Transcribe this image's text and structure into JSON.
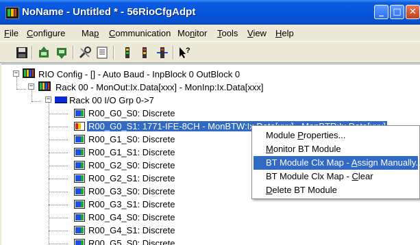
{
  "window": {
    "title": "NoName - Untitled * - 56RioCfgAdpt",
    "min_glyph": "_",
    "max_glyph": "□",
    "close_glyph": "✕"
  },
  "menubar": [
    {
      "key": "file",
      "pre": "",
      "u": "F",
      "post": "ile"
    },
    {
      "key": "configure",
      "pre": "",
      "u": "C",
      "post": "onfigure"
    },
    {
      "key": "map",
      "pre": "Ma",
      "u": "p",
      "post": ""
    },
    {
      "key": "communication",
      "pre": "",
      "u": "C",
      "post": "ommunication"
    },
    {
      "key": "monitor",
      "pre": "Mo",
      "u": "n",
      "post": "itor"
    },
    {
      "key": "tools",
      "pre": "",
      "u": "T",
      "post": "ools"
    },
    {
      "key": "view",
      "pre": "",
      "u": "V",
      "post": "iew"
    },
    {
      "key": "help",
      "pre": "",
      "u": "H",
      "post": "elp"
    }
  ],
  "toolbar": {
    "icons": [
      "save-icon",
      "upload-icon",
      "download-icon",
      "tools-icon",
      "properties-icon",
      "module-icon",
      "module-alt-icon",
      "module-io-icon",
      "help-pointer-icon"
    ]
  },
  "tree": {
    "root": "RIO Config - [] - Auto Baud - InpBlock 0 OutBlock 0",
    "rack": "Rack 00 - MonOut:Ix.Data[xxx] - MonInp:Ix.Data[xxx]",
    "group": "Rack 00 I/O Grp 0->7",
    "slots": [
      {
        "label": "R00_G0_S0: Discrete",
        "type": "discrete"
      },
      {
        "label": "R00_G0_S1: 1771-IFE-8CH - MonBTW:Ix.Data[xxx] - MonBTR:Ix.Data[xxx]",
        "type": "analog",
        "selected": true
      },
      {
        "label": "R00_G1_S0: Discrete",
        "type": "discrete"
      },
      {
        "label": "R00_G1_S1: Discrete",
        "type": "discrete"
      },
      {
        "label": "R00_G2_S0: Discrete",
        "type": "discrete"
      },
      {
        "label": "R00_G2_S1: Discrete",
        "type": "discrete"
      },
      {
        "label": "R00_G3_S0: Discrete",
        "type": "discrete"
      },
      {
        "label": "R00_G3_S1: Discrete",
        "type": "discrete"
      },
      {
        "label": "R00_G4_S0: Discrete",
        "type": "discrete"
      },
      {
        "label": "R00_G4_S1: Discrete",
        "type": "discrete"
      },
      {
        "label": "R00_G5_S0: Discrete",
        "type": "discrete"
      }
    ]
  },
  "context_menu": {
    "items": [
      {
        "pre": "Module ",
        "u": "P",
        "post": "roperties...",
        "highlighted": false
      },
      {
        "pre": "",
        "u": "M",
        "post": "onitor BT Module",
        "highlighted": false
      },
      {
        "pre": "BT Module Clx Map - ",
        "u": "A",
        "post": "ssign Manually...",
        "highlighted": true
      },
      {
        "pre": "BT Module Clx Map - ",
        "u": "C",
        "post": "lear",
        "highlighted": false
      },
      {
        "pre": "",
        "u": "D",
        "post": "elete BT Module",
        "highlighted": false
      }
    ]
  },
  "colors": {
    "title_blue": "#0553d8",
    "selection_blue": "#316ac5",
    "module_blue": "#1f4fe0",
    "module_green": "#1fa83a",
    "module_yellow": "#f4c20d",
    "module_red": "#d02a10",
    "group_blue": "#0a2ad8"
  }
}
